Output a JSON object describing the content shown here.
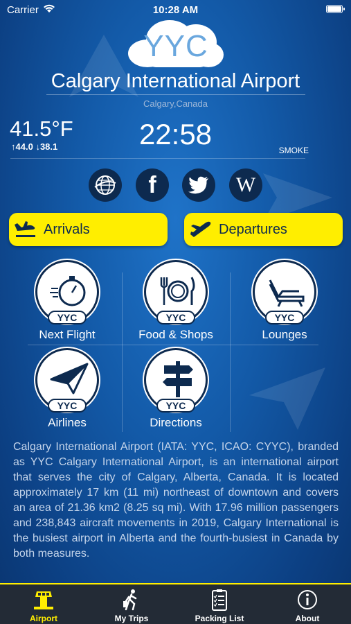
{
  "status_bar": {
    "carrier": "Carrier",
    "time": "10:28 AM"
  },
  "airport": {
    "code": "YYC",
    "name": "Calgary International Airport",
    "city": "Calgary,Canada"
  },
  "weather": {
    "temperature": "41.5°F",
    "high": "↑44.0",
    "low": "↓38.1",
    "local_time": "22:58",
    "condition": "SMOKE"
  },
  "social": [
    "web-icon",
    "facebook-icon",
    "twitter-icon",
    "wikipedia-icon"
  ],
  "buttons": {
    "arrivals": "Arrivals",
    "departures": "Departures"
  },
  "tiles": [
    {
      "label": "Next Flight",
      "badge": "YYC",
      "icon": "stopwatch-icon"
    },
    {
      "label": "Food & Shops",
      "badge": "YYC",
      "icon": "dining-icon"
    },
    {
      "label": "Lounges",
      "badge": "YYC",
      "icon": "lounge-chair-icon"
    },
    {
      "label": "Airlines",
      "badge": "YYC",
      "icon": "paper-plane-icon"
    },
    {
      "label": "Directions",
      "badge": "YYC",
      "icon": "signpost-icon"
    }
  ],
  "description": "Calgary International Airport (IATA: YYC, ICAO: CYYC), branded as YYC Calgary International Airport, is an international airport that serves the city of Calgary, Alberta, Canada. It is located approximately 17 km (11 mi) northeast of downtown and covers an area of 21.36 km2 (8.25 sq mi). With 17.96 million passengers and 238,843 aircraft movements in 2019, Calgary International is the busiest airport in Alberta and the fourth-busiest in Canada by both measures.",
  "tabbar": [
    {
      "label": "Airport",
      "icon": "control-tower-icon",
      "active": true
    },
    {
      "label": "My Trips",
      "icon": "traveler-icon",
      "active": false
    },
    {
      "label": "Packing List",
      "icon": "checklist-icon",
      "active": false
    },
    {
      "label": "About",
      "icon": "info-icon",
      "active": false
    }
  ],
  "colors": {
    "accent": "#ffee00",
    "navy": "#0d2a4f",
    "background": "#135aa8",
    "tabbar": "#232b36"
  }
}
